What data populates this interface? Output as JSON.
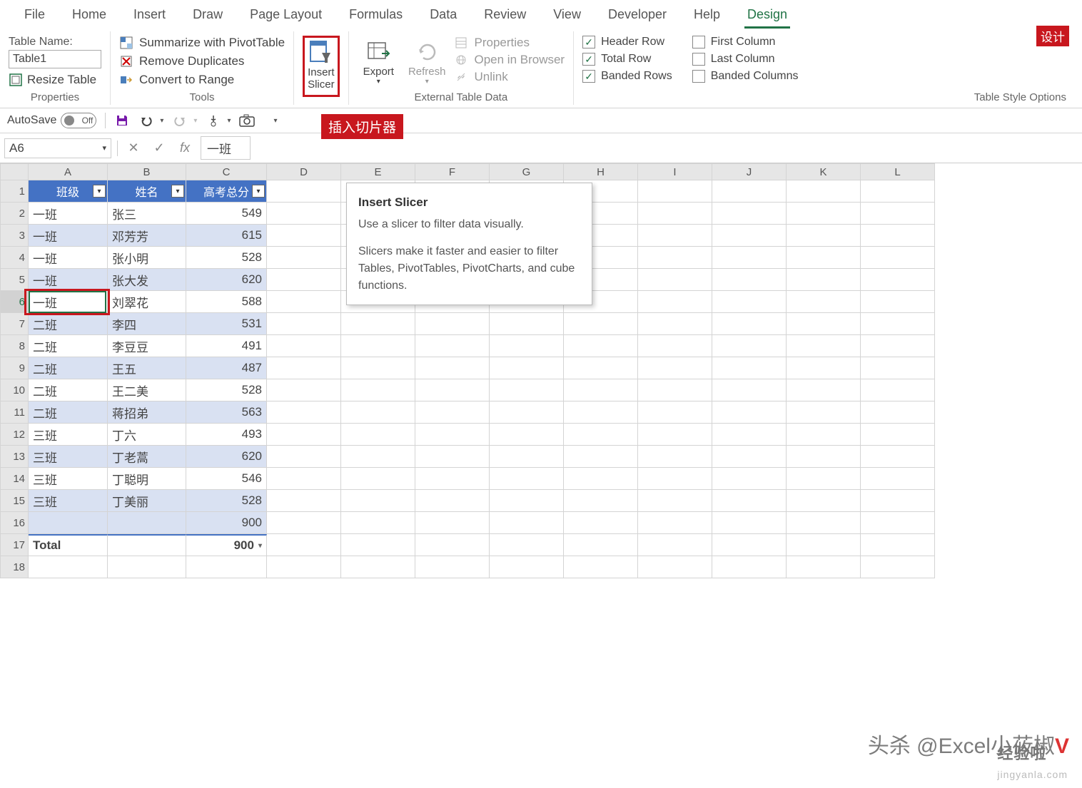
{
  "menu_tabs": [
    "File",
    "Home",
    "Insert",
    "Draw",
    "Page Layout",
    "Formulas",
    "Data",
    "Review",
    "View",
    "Developer",
    "Help",
    "Design"
  ],
  "active_tab": "Design",
  "design_red_label": "设计",
  "ribbon": {
    "properties": {
      "table_name_label": "Table Name:",
      "table_name_value": "Table1",
      "resize": "Resize Table",
      "group_label": "Properties"
    },
    "tools": {
      "pivot": "Summarize with PivotTable",
      "dup": "Remove Duplicates",
      "range": "Convert to Range",
      "group_label": "Tools"
    },
    "slicer": {
      "line1": "Insert",
      "line2": "Slicer",
      "caption": "插入切片器"
    },
    "export": "Export",
    "refresh": "Refresh",
    "ext": {
      "props": "Properties",
      "browser": "Open in Browser",
      "unlink": "Unlink",
      "group_label": "External Table Data"
    },
    "style_opts": {
      "header": "Header Row",
      "total": "Total Row",
      "banded_rows": "Banded Rows",
      "first_col": "First Column",
      "last_col": "Last Column",
      "banded_cols": "Banded Columns",
      "group_label": "Table Style Options"
    }
  },
  "qat": {
    "autosave": "AutoSave",
    "autosave_state": "Off"
  },
  "namebox": "A6",
  "formula_value": "一班",
  "tooltip": {
    "title": "Insert Slicer",
    "line1": "Use a slicer to filter data visually.",
    "line2": "Slicers make it faster and easier to filter Tables, PivotTables, PivotCharts, and cube functions."
  },
  "columns": [
    "A",
    "B",
    "C",
    "D",
    "E",
    "F",
    "G",
    "H",
    "I",
    "J",
    "K",
    "L"
  ],
  "headers": [
    "班级",
    "姓名",
    "高考总分"
  ],
  "rows": [
    {
      "c": [
        "一班",
        "张三",
        "549"
      ]
    },
    {
      "c": [
        "一班",
        "邓芳芳",
        "615"
      ]
    },
    {
      "c": [
        "一班",
        "张小明",
        "528"
      ]
    },
    {
      "c": [
        "一班",
        "张大发",
        "620"
      ]
    },
    {
      "c": [
        "一班",
        "刘翠花",
        "588"
      ]
    },
    {
      "c": [
        "二班",
        "李四",
        "531"
      ]
    },
    {
      "c": [
        "二班",
        "李豆豆",
        "491"
      ]
    },
    {
      "c": [
        "二班",
        "王五",
        "487"
      ]
    },
    {
      "c": [
        "二班",
        "王二美",
        "528"
      ]
    },
    {
      "c": [
        "二班",
        "蒋招弟",
        "563"
      ]
    },
    {
      "c": [
        "三班",
        "丁六",
        "493"
      ]
    },
    {
      "c": [
        "三班",
        "丁老蒿",
        "620"
      ]
    },
    {
      "c": [
        "三班",
        "丁聪明",
        "546"
      ]
    },
    {
      "c": [
        "三班",
        "丁美丽",
        "528"
      ]
    }
  ],
  "blank_row_total": "900",
  "total_row": {
    "label": "Total",
    "value": "900"
  },
  "watermark1_a": "头杀 @Excel小莜椒",
  "watermark1_b": "V",
  "watermark2_a": "经验啦",
  "watermark2_b": "jingyanla.com"
}
